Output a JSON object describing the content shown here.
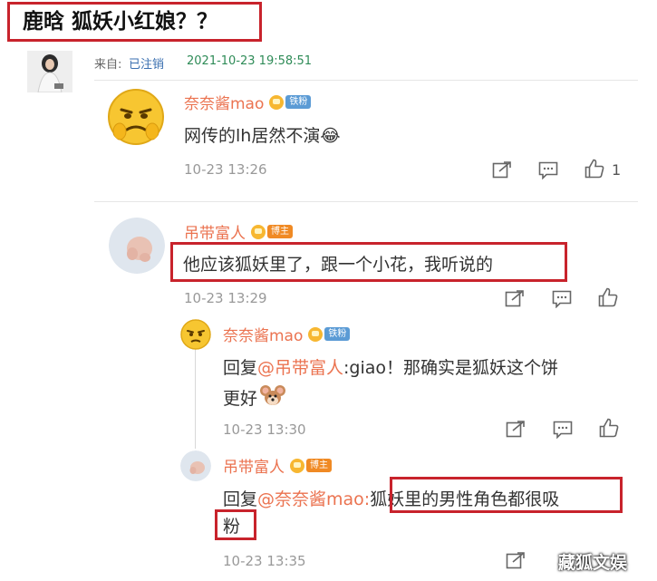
{
  "post": {
    "title": "鹿晗 狐妖小红娘？？",
    "source_label": "来自:",
    "source_value": "已注销",
    "timestamp": "2021-10-23 19:58:51"
  },
  "comments": [
    {
      "user": "奈奈酱mao",
      "badge": "铁粉",
      "text": "网传的lh居然不演",
      "emoji": "😂",
      "time": "10-23 13:26",
      "likes": "1"
    },
    {
      "user": "吊带富人",
      "badge": "博主",
      "text": "他应该狐妖里了，跟一个小花，我听说的",
      "time": "10-23 13:29"
    }
  ],
  "replies": [
    {
      "user": "奈奈酱mao",
      "badge": "铁粉",
      "reply_prefix": "回复",
      "mention": "@吊带富人",
      "text_line1": ":giao！那确实是狐妖这个饼",
      "text_line2": "更好",
      "time": "10-23 13:30"
    },
    {
      "user": "吊带富人",
      "badge": "博主",
      "reply_prefix": "回复",
      "mention": "@奈奈酱mao:",
      "text_line1": "狐妖里的男性角色都很吸",
      "text_line2": "粉",
      "time": "10-23 13:35"
    }
  ],
  "watermark": "藏狐文娱",
  "colors": {
    "highlight_border": "#c8232c",
    "username": "#eb7350",
    "timestamp_green": "#2e8b57",
    "link_blue": "#3a6fb0"
  }
}
